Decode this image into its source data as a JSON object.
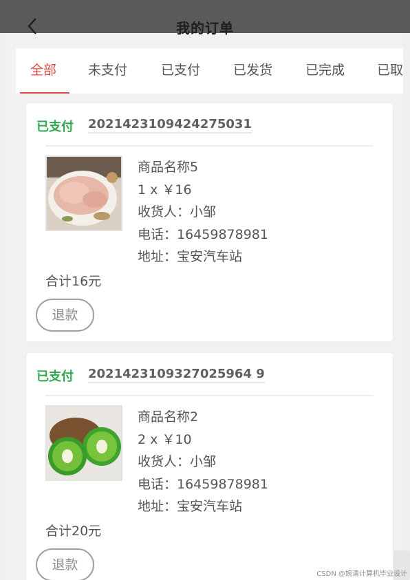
{
  "header": {
    "title": "我的订单",
    "back_icon": "chevron-left-icon"
  },
  "tabs": [
    {
      "label": "全部",
      "active": true
    },
    {
      "label": "未支付",
      "active": false
    },
    {
      "label": "已支付",
      "active": false
    },
    {
      "label": "已发货",
      "active": false
    },
    {
      "label": "已完成",
      "active": false
    },
    {
      "label": "已取",
      "active": false
    }
  ],
  "orders": [
    {
      "status": "已支付",
      "order_no": "2021423109424275031",
      "product_image": "raw-chicken-image",
      "product_name": "商品名称5",
      "qty_price": "1 x ￥16",
      "receiver": "收货人：小邹",
      "phone": "电话：16459878981",
      "address": "地址：宝安汽车站",
      "total": "合计16元",
      "refund_label": "退款"
    },
    {
      "status": "已支付",
      "order_no": "2021423109327025964 9",
      "product_image": "kiwi-image",
      "product_name": "商品名称2",
      "qty_price": "2 x ￥10",
      "receiver": "收货人：小邹",
      "phone": "电话：16459878981",
      "address": "地址：宝安汽车站",
      "total": "合计20元",
      "refund_label": "退款"
    }
  ],
  "watermark": "CSDN @婉清计算机毕业设计",
  "colors": {
    "active_tab": "#e04b44",
    "status_paid": "#2fa84f",
    "header_overlay": "#5a5a5a"
  }
}
